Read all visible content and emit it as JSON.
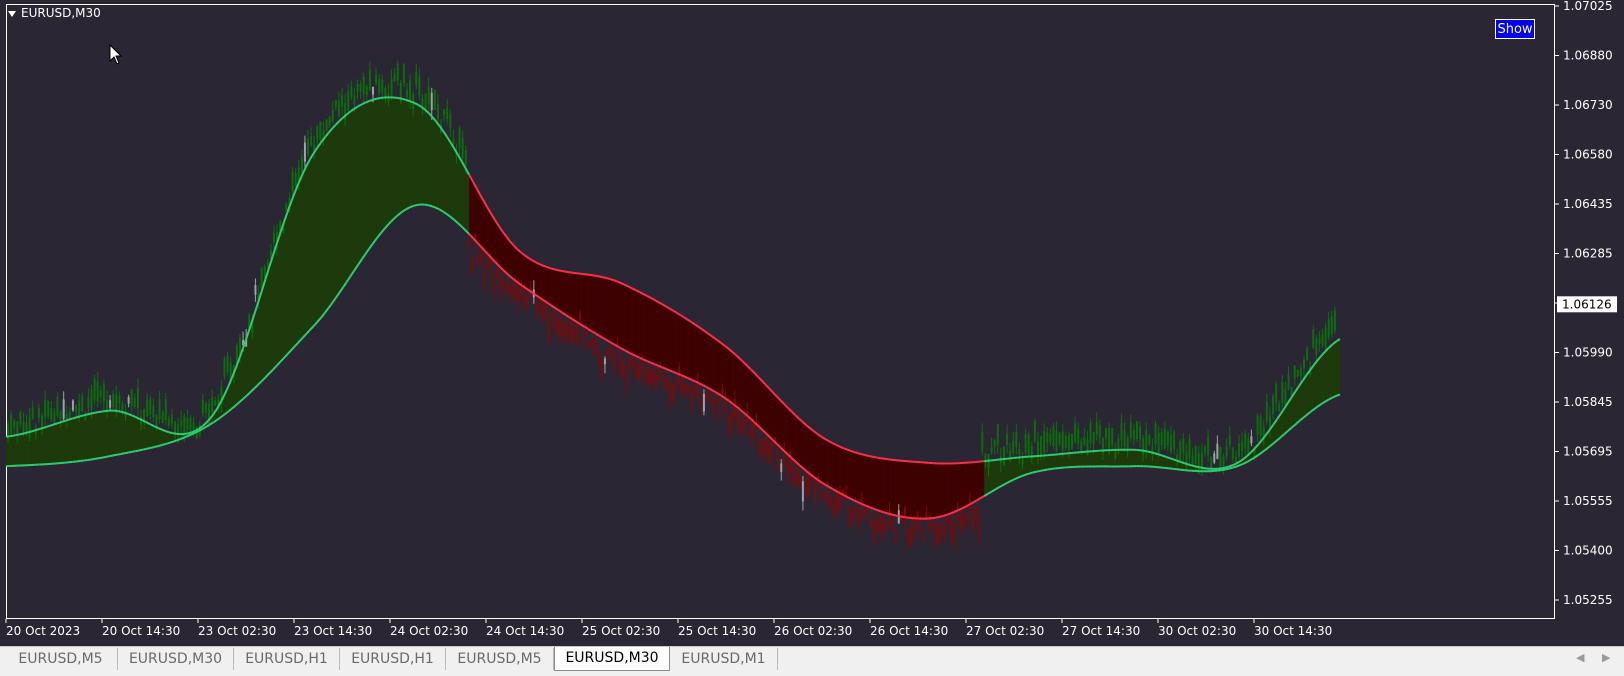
{
  "chart": {
    "symbol_title": "EURUSD,M30",
    "show_button_label": "Show",
    "current_price_label": "1.06126",
    "colors": {
      "background": "#2a2633",
      "bull_candle": "#0b6e0b",
      "bear_candle": "#7a0a0a",
      "doji_candle": "#a0a0a8",
      "bull_line": "#2ecc71",
      "bear_line": "#ff2e4a",
      "bull_fill": "#1d3a0b",
      "bear_fill": "#3e0000",
      "axis_text": "#ffffff",
      "axis_line": "#ffffff",
      "price_tag_bg": "#ffffff",
      "price_tag_text": "#000000"
    },
    "y_axis": {
      "min": 1.0522,
      "max": 1.0704,
      "ticks": [
        "1.07025",
        "1.06880",
        "1.06730",
        "1.06580",
        "1.06435",
        "1.06285",
        "1.06140",
        "1.05990",
        "1.05845",
        "1.05695",
        "1.05555",
        "1.05400",
        "1.05255"
      ]
    },
    "x_axis": {
      "ticks": [
        "20 Oct 2023",
        "20 Oct 14:30",
        "23 Oct 02:30",
        "23 Oct 14:30",
        "24 Oct 02:30",
        "24 Oct 14:30",
        "25 Oct 02:30",
        "25 Oct 14:30",
        "26 Oct 02:30",
        "26 Oct 14:30",
        "27 Oct 02:30",
        "27 Oct 14:30",
        "30 Oct 02:30",
        "30 Oct 14:30"
      ]
    }
  },
  "chart_data": {
    "type": "line",
    "title": "EURUSD,M30",
    "xlabel": "",
    "ylabel": "",
    "ylim": [
      1.0522,
      1.0704
    ],
    "x": [
      "20 Oct 2023",
      "20 Oct 14:30",
      "23 Oct 02:30",
      "23 Oct 14:30",
      "24 Oct 02:30",
      "24 Oct 14:30",
      "25 Oct 02:30",
      "25 Oct 14:30",
      "26 Oct 02:30",
      "26 Oct 14:30",
      "27 Oct 02:30",
      "27 Oct 14:30",
      "30 Oct 02:30",
      "30 Oct 14:30"
    ],
    "series": [
      {
        "values": [
          1.0563,
          1.0566,
          1.0576,
          1.0606,
          1.0643,
          1.0619,
          1.0599,
          1.0584,
          1.0557,
          1.0547,
          1.0561,
          1.0563,
          1.0563,
          1.0585
        ]
      },
      {
        "values": [
          1.0572,
          1.058,
          1.0578,
          1.0659,
          1.0674,
          1.0629,
          1.0619,
          1.06,
          1.0571,
          1.0564,
          1.0566,
          1.0568,
          1.0564,
          1.0602
        ]
      }
    ],
    "last_price": 1.06126,
    "grid": false
  },
  "tabs": [
    {
      "label": "EURUSD,M5",
      "active": false
    },
    {
      "label": "EURUSD,M30",
      "active": false
    },
    {
      "label": "EURUSD,H1",
      "active": false
    },
    {
      "label": "EURUSD,H1",
      "active": false
    },
    {
      "label": "EURUSD,M5",
      "active": false
    },
    {
      "label": "EURUSD,M30",
      "active": true
    },
    {
      "label": "EURUSD,M1",
      "active": false
    }
  ]
}
